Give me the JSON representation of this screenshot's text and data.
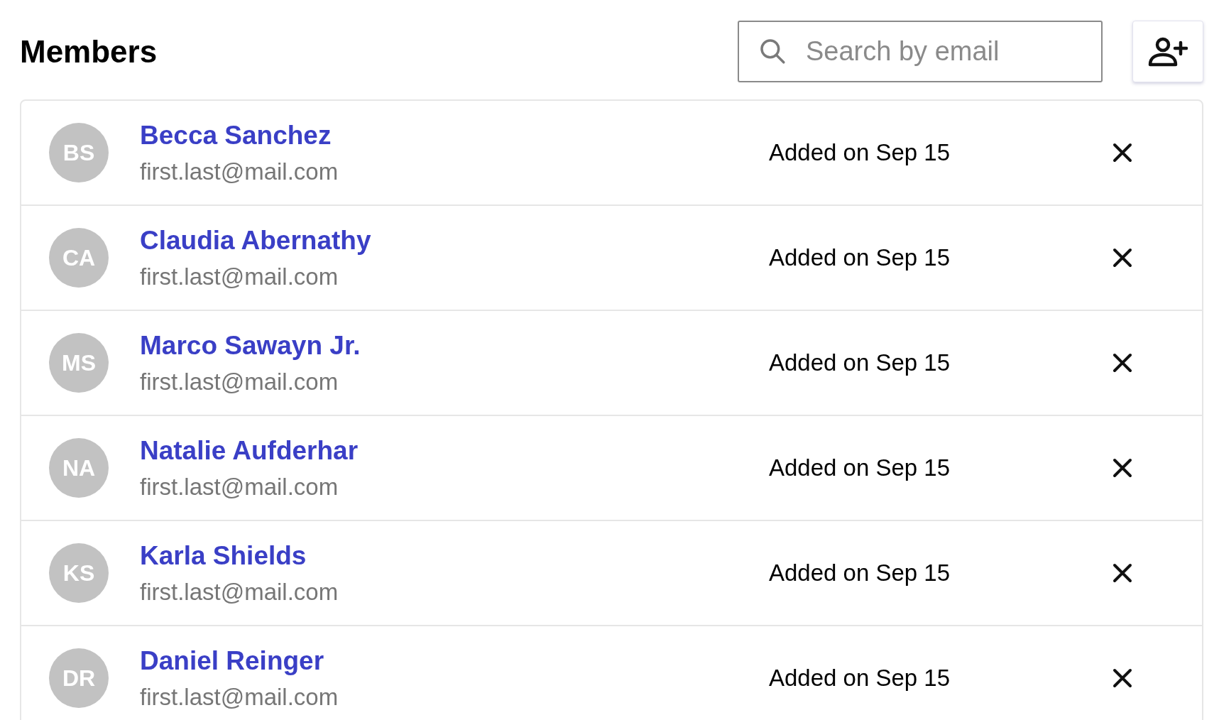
{
  "header": {
    "title": "Members",
    "search": {
      "placeholder": "Search by email"
    }
  },
  "members": [
    {
      "initials": "BS",
      "name": "Becca Sanchez",
      "email": "first.last@mail.com",
      "added": "Added on Sep 15"
    },
    {
      "initials": "CA",
      "name": "Claudia Abernathy",
      "email": "first.last@mail.com",
      "added": "Added on Sep 15"
    },
    {
      "initials": "MS",
      "name": "Marco Sawayn Jr.",
      "email": "first.last@mail.com",
      "added": "Added on Sep 15"
    },
    {
      "initials": "NA",
      "name": "Natalie Aufderhar",
      "email": "first.last@mail.com",
      "added": "Added on Sep 15"
    },
    {
      "initials": "KS",
      "name": "Karla Shields",
      "email": "first.last@mail.com",
      "added": "Added on Sep 15"
    },
    {
      "initials": "DR",
      "name": "Daniel Reinger",
      "email": "first.last@mail.com",
      "added": "Added on Sep 15"
    }
  ]
}
